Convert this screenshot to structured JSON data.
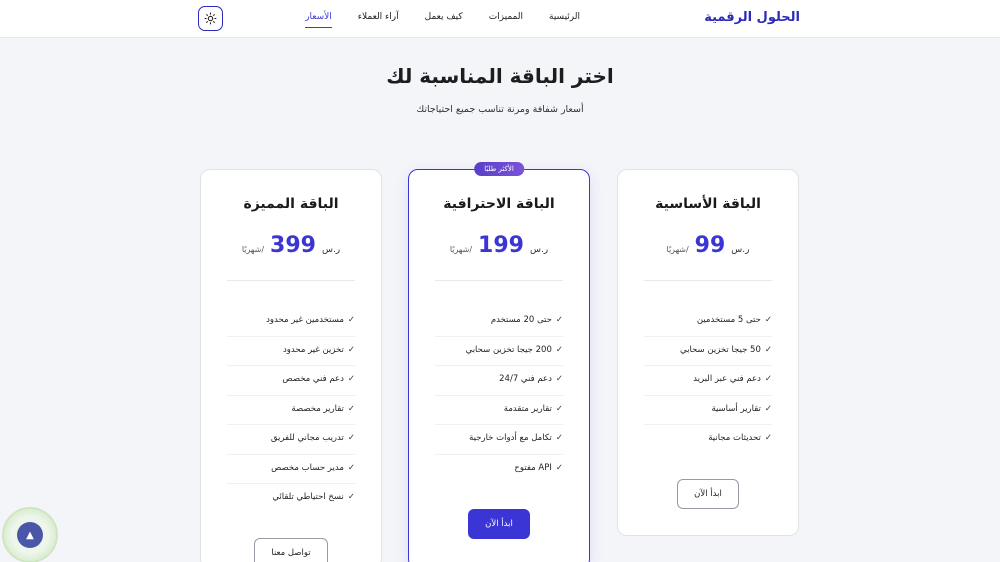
{
  "header": {
    "logo": "الحلول الرقمية",
    "nav": [
      {
        "label": "الرئيسية",
        "active": false
      },
      {
        "label": "المميزات",
        "active": false
      },
      {
        "label": "كيف يعمل",
        "active": false
      },
      {
        "label": "آراء العملاء",
        "active": false
      },
      {
        "label": "الأسعار",
        "active": true
      }
    ],
    "theme_toggle_icon": "sun-icon"
  },
  "hero": {
    "title": "اختر الباقة المناسبة لك",
    "subtitle": "أسعار شفافة ومرنة تناسب جميع احتياجاتك"
  },
  "plans": [
    {
      "name": "الباقة الأساسية",
      "currency": "ر.س",
      "price": "99",
      "period": "/شهريًا",
      "features": [
        "حتى 5 مستخدمين",
        "50 جيجا تخزين سحابي",
        "دعم فني عبر البريد",
        "تقارير أساسية",
        "تحديثات مجانية"
      ],
      "cta": "ابدأ الآن",
      "featured": false
    },
    {
      "name": "الباقة الاحترافية",
      "badge": "الأكثر طلبًا",
      "currency": "ر.س",
      "price": "199",
      "period": "/شهريًا",
      "features": [
        "حتى 20 مستخدم",
        "200 جيجا تخزين سحابي",
        "دعم فني 24/7",
        "تقارير متقدمة",
        "تكامل مع أدوات خارجية",
        "API مفتوح"
      ],
      "cta": "ابدأ الآن",
      "featured": true
    },
    {
      "name": "الباقة المميزة",
      "currency": "ر.س",
      "price": "399",
      "period": "/شهريًا",
      "features": [
        "مستخدمين غير محدود",
        "تخزين غير محدود",
        "دعم فني مخصص",
        "تقارير مخصصة",
        "تدريب مجاني للفريق",
        "مدير حساب مخصص",
        "نسخ احتياطي تلقائي"
      ],
      "cta": "تواصل معنا",
      "featured": false
    }
  ],
  "check_mark": "✓",
  "colors": {
    "accent": "#3b35d6",
    "logo": "#2d2ab8",
    "background": "#f4f5f9"
  }
}
